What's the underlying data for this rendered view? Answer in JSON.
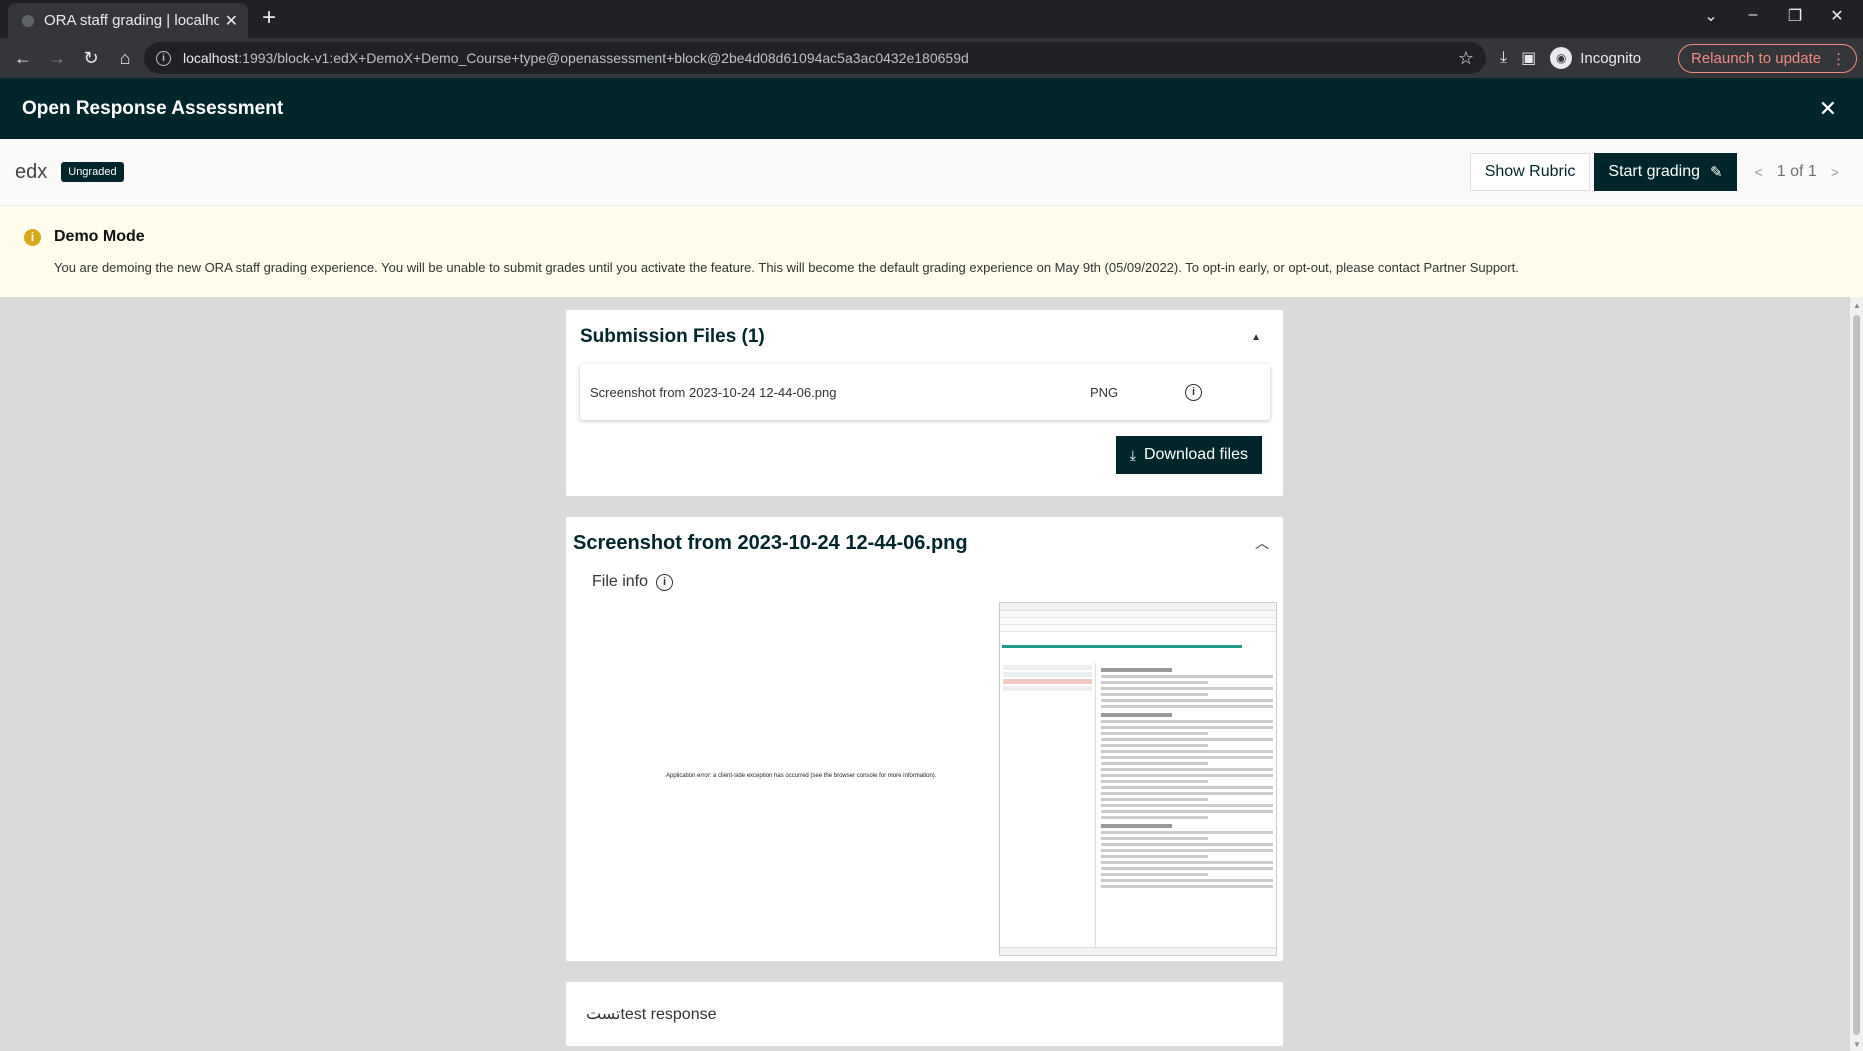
{
  "browser": {
    "tab_title": "ORA staff grading | localhost",
    "new_tab": "+",
    "url_host": "localhost",
    "url_rest": ":1993/block-v1:edX+DemoX+Demo_Course+type@openassessment+block@2be4d08d61094ac5a3ac0432e180659d",
    "incognito_label": "Incognito",
    "relaunch_label": "Relaunch to update"
  },
  "header": {
    "title": "Open Response Assessment"
  },
  "subheader": {
    "learner": "edx",
    "status_badge": "Ungraded",
    "show_rubric": "Show Rubric",
    "start_grading": "Start grading",
    "pager": "1 of 1"
  },
  "demo": {
    "title": "Demo Mode",
    "text": "You are demoing the new ORA staff grading experience. You will be unable to submit grades until you activate the feature. This will become the default grading experience on May 9th (05/09/2022). To opt-in early, or opt-out, please contact Partner Support."
  },
  "submission_files": {
    "title": "Submission Files (1)",
    "files": [
      {
        "name": "Screenshot from 2023-10-24 12-44-06.png",
        "type": "PNG"
      }
    ],
    "download_label": "Download files"
  },
  "file_preview": {
    "title": "Screenshot from 2023-10-24 12-44-06.png",
    "file_info_label": "File info",
    "error_text": "Application error: a client-side exception has occurred (see the browser console for more information)."
  },
  "response": {
    "text": "تستtest response"
  }
}
